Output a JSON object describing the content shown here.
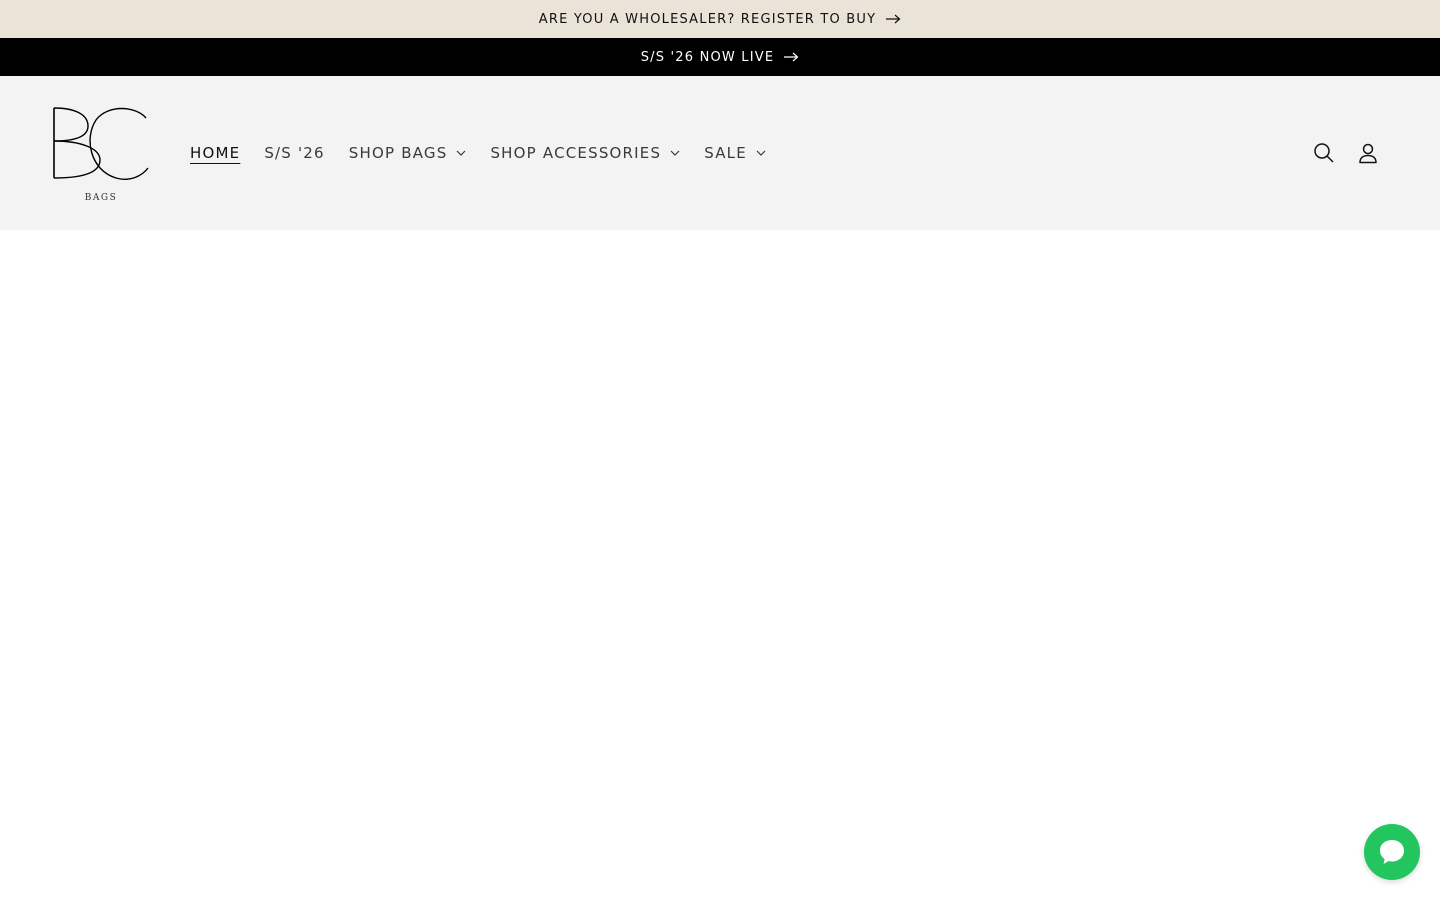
{
  "announcements": [
    {
      "text": "ARE YOU A WHOLESALER? REGISTER TO BUY",
      "icon": "arrow-right-icon"
    },
    {
      "text": "S/S '26 NOW LIVE",
      "icon": "arrow-right-icon"
    }
  ],
  "header": {
    "logo": {
      "subtitle": "BAGS",
      "monogram": "BC"
    },
    "nav": [
      {
        "label": "HOME",
        "active": true,
        "dropdown": false
      },
      {
        "label": "S/S '26",
        "active": false,
        "dropdown": false
      },
      {
        "label": "SHOP BAGS",
        "active": false,
        "dropdown": true
      },
      {
        "label": "SHOP ACCESSORIES",
        "active": false,
        "dropdown": true
      },
      {
        "label": "SALE",
        "active": false,
        "dropdown": true
      }
    ],
    "icons": [
      "search-icon",
      "account-icon"
    ]
  },
  "chat": {
    "icon": "chat-bubble-icon",
    "color": "#23c55e"
  },
  "colors": {
    "announcement_bg": "#e9e3d8",
    "promo_bg": "#000000",
    "header_bg": "#f3f3f3"
  }
}
